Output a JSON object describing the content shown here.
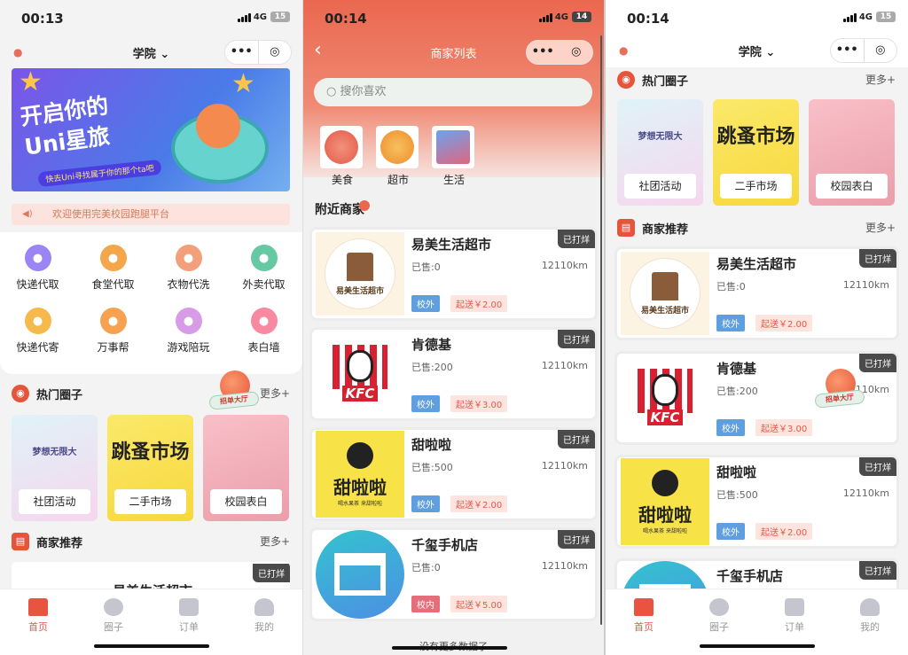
{
  "status": {
    "left": {
      "time": "00:13",
      "net": "4G",
      "battery": "15"
    },
    "mid": {
      "time": "00:14",
      "net": "4G",
      "battery": "14"
    },
    "right": {
      "time": "00:14",
      "net": "4G",
      "battery": "15"
    }
  },
  "nav": {
    "location": "学院",
    "capsule_more": "•••",
    "capsule_close": "◎",
    "list_title": "商家列表",
    "back": "‹"
  },
  "banner": {
    "title_line1": "开启你的",
    "title_line2": "Uni星旅",
    "subtitle": "快去Uni寻找属于你的那个ta吧"
  },
  "notice": "欢迎使用完美校园跑腿平台",
  "services": [
    {
      "label": "快递代取",
      "icon": "package-icon",
      "color": "#9b84f3"
    },
    {
      "label": "食堂代取",
      "icon": "canteen-icon",
      "color": "#f3a64a"
    },
    {
      "label": "衣物代洗",
      "icon": "laundry-icon",
      "color": "#f2a07b"
    },
    {
      "label": "外卖代取",
      "icon": "takeout-icon",
      "color": "#67c8a4"
    },
    {
      "label": "快递代寄",
      "icon": "send-icon",
      "color": "#f6b94c"
    },
    {
      "label": "万事帮",
      "icon": "help-icon",
      "color": "#f7a252"
    },
    {
      "label": "游戏陪玩",
      "icon": "game-icon",
      "color": "#d79be8"
    },
    {
      "label": "表白墙",
      "icon": "heart-icon",
      "color": "#f78aa0"
    }
  ],
  "hot": {
    "title": "热门圈子",
    "more": "更多+",
    "items": [
      {
        "label": "社团活动",
        "deco": "梦想无限大",
        "bg": "linear-gradient(160deg,#dff3f8,#f6d6ee)"
      },
      {
        "label": "二手市场",
        "deco": "跳蚤市场",
        "bg": "linear-gradient(160deg,#fbe96a,#f7d83c)"
      },
      {
        "label": "校园表白",
        "deco": "",
        "bg": "linear-gradient(160deg,#f8c0c8,#eb9eaa)"
      }
    ]
  },
  "merchants_section": {
    "title": "商家推荐",
    "more": "更多+"
  },
  "hall_badge": "招单大厅",
  "categories": [
    {
      "label": "美食",
      "icon": "food-icon"
    },
    {
      "label": "超市",
      "icon": "store-icon"
    },
    {
      "label": "生活",
      "icon": "life-icon"
    }
  ],
  "search_placeholder": "搜你喜欢",
  "nearby_title": "附近商家",
  "merchants": [
    {
      "name": "易美生活超市",
      "sold": "已售:0",
      "distance": "12110km",
      "tag": "校外",
      "fee": "起送￥2.00",
      "status": "已打烊",
      "logo_text": "易美生活超市"
    },
    {
      "name": "肯德基",
      "sold": "已售:200",
      "distance": "12110km",
      "tag": "校外",
      "fee": "起送￥3.00",
      "status": "已打烊",
      "logo_text": "KFC"
    },
    {
      "name": "甜啦啦",
      "sold": "已售:500",
      "distance": "12110km",
      "tag": "校外",
      "fee": "起送￥2.00",
      "status": "已打烊",
      "logo_text": "甜啦啦",
      "logo_sub": "喝水果茶 来甜啦啦"
    },
    {
      "name": "千玺手机店",
      "sold": "已售:0",
      "distance": "12110km",
      "tag": "校内",
      "fee": "起送￥5.00",
      "status": "已打烊"
    }
  ],
  "no_more": "没有更多数据了",
  "tabs": [
    {
      "label": "首页",
      "icon": "home-icon"
    },
    {
      "label": "圈子",
      "icon": "circle-icon"
    },
    {
      "label": "订单",
      "icon": "order-icon"
    },
    {
      "label": "我的",
      "icon": "profile-icon"
    }
  ]
}
